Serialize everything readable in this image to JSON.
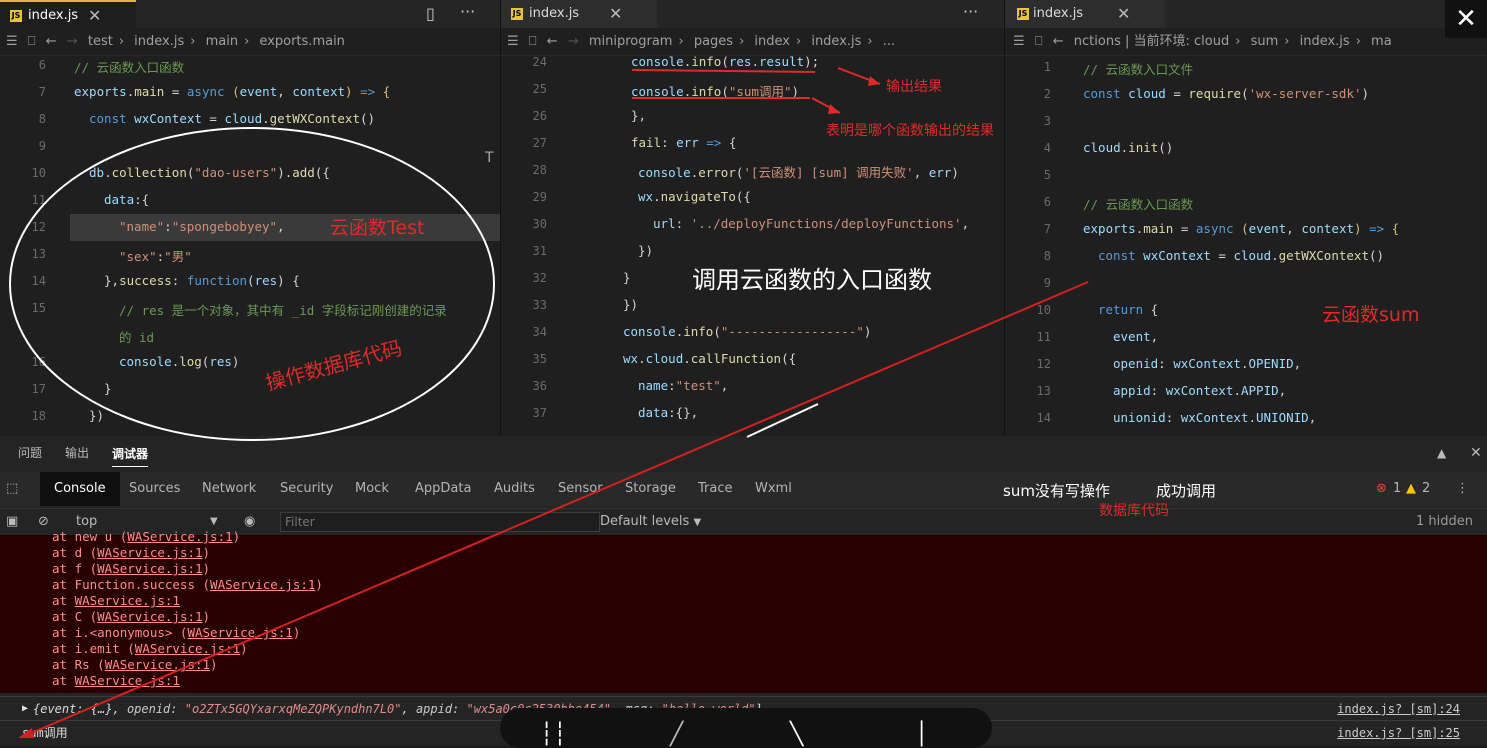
{
  "pane1": {
    "tab": "index.js",
    "breadcrumb": [
      "test",
      "index.js",
      "main",
      "exports.main"
    ],
    "line_numbers": [
      "6",
      "7",
      "8",
      "9",
      "10",
      "11",
      "12",
      "13",
      "14",
      "15",
      "",
      "16",
      "17",
      "18"
    ]
  },
  "pane2": {
    "tab": "index.js",
    "breadcrumb": [
      "miniprogram",
      "pages",
      "index",
      "index.js",
      "..."
    ],
    "line_numbers": [
      "24",
      "25",
      "26",
      "27",
      "28",
      "29",
      "30",
      "31",
      "32",
      "33",
      "34",
      "35",
      "36",
      "37"
    ]
  },
  "pane3": {
    "tab": "index.js",
    "breadcrumb": [
      "nctions | 当前环境: cloud",
      "sum",
      "index.js",
      "ma"
    ],
    "line_numbers": [
      "1",
      "2",
      "3",
      "4",
      "5",
      "6",
      "7",
      "8",
      "9",
      "10",
      "11",
      "12",
      "13",
      "14"
    ]
  },
  "annotations": {
    "output_result": "输出结果",
    "which_function": "表明是哪个函数输出的结果",
    "cloud_test": "云函数Test",
    "db_code": "操作数据库代码",
    "entry_function": "调用云函数的入口函数",
    "cloud_sum": "云函数sum",
    "sum_no_write": "sum没有写操作",
    "success_call": "成功调用",
    "db_code_small": "数据库代码"
  },
  "devtools": {
    "panel_tabs": [
      "问题",
      "输出",
      "调试器"
    ],
    "tabs": [
      "Console",
      "Sources",
      "Network",
      "Security",
      "Mock",
      "AppData",
      "Audits",
      "Sensor",
      "Storage",
      "Trace",
      "Wxml"
    ],
    "error_count": "1",
    "warning_count": "2",
    "context": "top",
    "filter_placeholder": "Filter",
    "levels": "Default levels",
    "hidden": "1 hidden",
    "stack": [
      {
        "pre": "at new u (",
        "link": "WAService.js:1",
        "post": ")"
      },
      {
        "pre": "at d (",
        "link": "WAService.js:1",
        "post": ")"
      },
      {
        "pre": "at f (",
        "link": "WAService.js:1",
        "post": ")"
      },
      {
        "pre": "at Function.success (",
        "link": "WAService.js:1",
        "post": ")"
      },
      {
        "pre": "at ",
        "link": "WAService.js:1",
        "post": ""
      },
      {
        "pre": "at C (",
        "link": "WAService.js:1",
        "post": ")"
      },
      {
        "pre": "at i.<anonymous> (",
        "link": "WAService.js:1",
        "post": ")"
      },
      {
        "pre": "at i.emit (",
        "link": "WAService.js:1",
        "post": ")"
      },
      {
        "pre": "at Rs (",
        "link": "WAService.js:1",
        "post": ")"
      },
      {
        "pre": "at ",
        "link": "WAService.js:1",
        "post": ""
      }
    ],
    "log1": {
      "event": "event: {…}",
      "openid_key": "openid:",
      "openid": "\"o2ZTx5GQYxarxqMeZQPKyndhn7L0\"",
      "appid_key": "appid:",
      "appid": "\"wx5a0c0c2530bbe454\"",
      "msg_key": "msg:",
      "msg": "\"hello world\"",
      "source": "index.js? [sm]:24"
    },
    "log2": {
      "text": "sum调用",
      "source": "index.js? [sm]:25"
    }
  },
  "colors": {
    "annotation": "#e02a2a",
    "accent": "#e2b340"
  }
}
